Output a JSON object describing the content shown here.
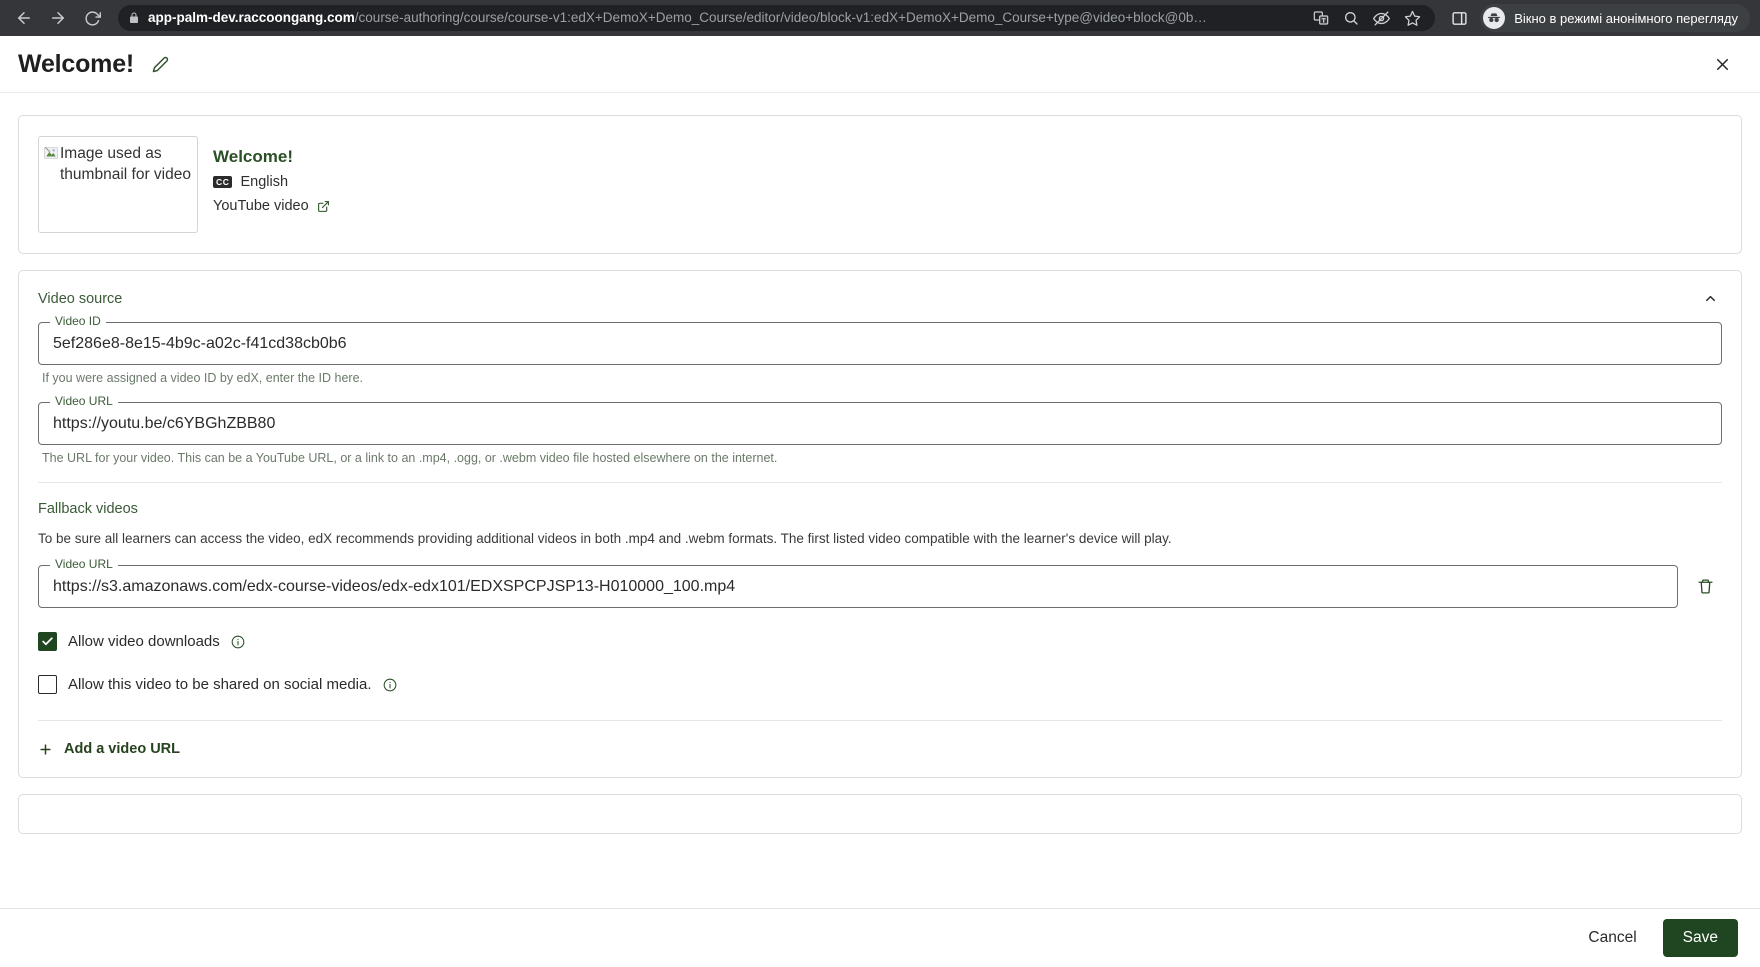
{
  "browser": {
    "url_domain": "app-palm-dev.raccoongang.com",
    "url_path": "/course-authoring/course/course-v1:edX+DemoX+Demo_Course/editor/video/block-v1:edX+DemoX+Demo_Course+type@video+block@0b…",
    "incognito_label": "Вікно в режимі анонімного перегляду",
    "icons": {
      "back": "back-arrow-icon",
      "forward": "forward-arrow-icon",
      "reload": "reload-icon",
      "lock": "lock-icon",
      "translate": "translate-icon",
      "zoom": "search-zoom-icon",
      "tracking": "tracking-protection-icon",
      "bookmark": "star-bookmark-icon",
      "side_panel": "side-panel-icon",
      "incognito": "incognito-icon"
    }
  },
  "header": {
    "title": "Welcome!",
    "edit_icon": "pencil-icon",
    "close_icon": "close-icon"
  },
  "video_card": {
    "thumbnail_alt": "Image used as thumbnail for video",
    "name": "Welcome!",
    "cc_badge": "CC",
    "language": "English",
    "source_label": "YouTube video",
    "external_icon": "external-link-icon"
  },
  "video_source": {
    "section_title": "Video source",
    "collapse_icon": "chevron-up-icon",
    "video_id": {
      "label": "Video ID",
      "value": "5ef286e8-8e15-4b9c-a02c-f41cd38cb0b6",
      "placeholder": "Video ID",
      "help": "If you were assigned a video ID by edX, enter the ID here."
    },
    "video_url": {
      "label": "Video URL",
      "value": "https://youtu.be/c6YBGhZBB80",
      "placeholder": "Video URL",
      "help": "The URL for your video. This can be a YouTube URL, or a link to an .mp4, .ogg, or .webm video file hosted elsewhere on the internet."
    },
    "fallback": {
      "title": "Fallback videos",
      "description": "To be sure all learners can access the video, edX recommends providing additional videos in both .mp4 and .webm formats. The first listed video compatible with the learner's device will play.",
      "url_label": "Video URL",
      "url_value": "https://s3.amazonaws.com/edx-course-videos/edx-edx101/EDXSPCPJSP13-H010000_100.mp4",
      "url_placeholder": "Video URL",
      "delete_icon": "trash-icon"
    },
    "checkboxes": [
      {
        "label": "Allow video downloads",
        "checked": true,
        "info_icon": "info-icon"
      },
      {
        "label": "Allow this video to be shared on social media.",
        "checked": false,
        "info_icon": "info-icon"
      }
    ],
    "add_url_label": "Add a video URL",
    "add_icon": "plus-icon"
  },
  "footer": {
    "cancel_label": "Cancel",
    "save_label": "Save"
  },
  "colors": {
    "brand_green": "#1f4620",
    "link_green": "#27421f",
    "label_green": "#3a5a37",
    "chrome_bg": "#35363a"
  }
}
